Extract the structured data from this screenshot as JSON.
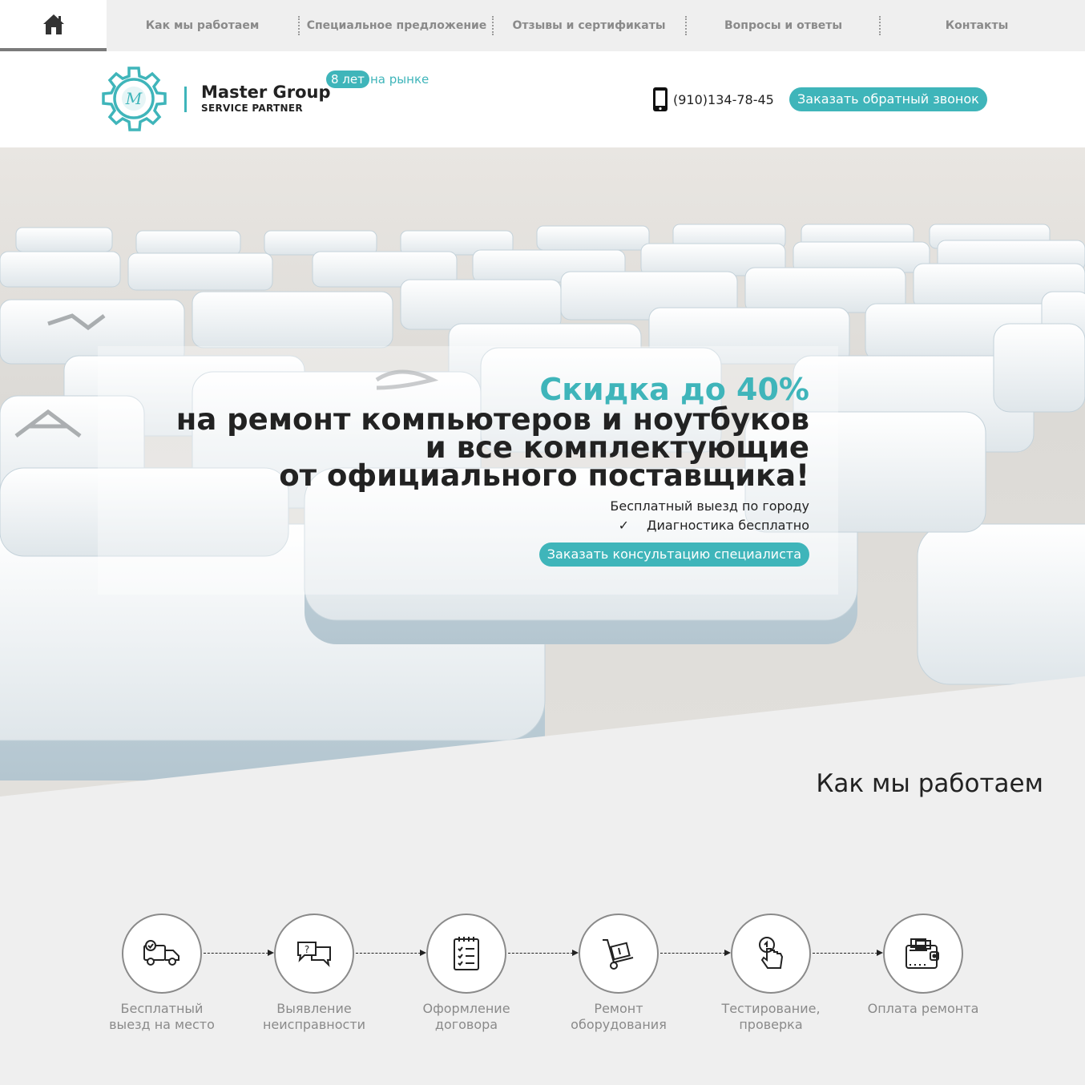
{
  "nav": {
    "home_icon": "home-icon",
    "items": [
      {
        "label": "Как мы работаем"
      },
      {
        "label": "Специальное предложение"
      },
      {
        "label": "Отзывы и сертификаты"
      },
      {
        "label": "Вопросы и ответы"
      },
      {
        "label": "Контакты"
      }
    ]
  },
  "header": {
    "brand_name": "Master Group",
    "brand_sub": "SERVICE PARTNER",
    "years_badge": "8 лет",
    "years_text": "на рынке",
    "phone": "(910)134-78-45",
    "callback_label": "Заказать обратный звонок"
  },
  "hero": {
    "title": "Скидка до 40%",
    "lines": [
      "на ремонт компьютеров и ноутбуков",
      "и все комплектующие",
      "от официального поставщика!"
    ],
    "feature_1": "Бесплатный выезд по городу",
    "feature_2": "Диагностика бесплатно",
    "feature_check": "✓",
    "consult_label": "Заказать консультацию специалиста"
  },
  "how_we_work": {
    "title": "Как мы работаем",
    "steps": [
      {
        "icon": "truck-icon",
        "label_1": "Бесплатный",
        "label_2": "выезд на место"
      },
      {
        "icon": "chat-question-icon",
        "label_1": "Выявление",
        "label_2": "неисправности"
      },
      {
        "icon": "checklist-icon",
        "label_1": "Оформление",
        "label_2": "договора"
      },
      {
        "icon": "hand-cart-icon",
        "label_1": "Ремонт",
        "label_2": "оборудования"
      },
      {
        "icon": "touch-icon",
        "label_1": "Тестирование,",
        "label_2": "проверка"
      },
      {
        "icon": "wallet-icon",
        "label_1": "Оплата ремонта",
        "label_2": ""
      }
    ]
  },
  "colors": {
    "accent": "#3fb5ba",
    "nav_bg": "#efefef",
    "muted_text": "#8a8a8a"
  }
}
